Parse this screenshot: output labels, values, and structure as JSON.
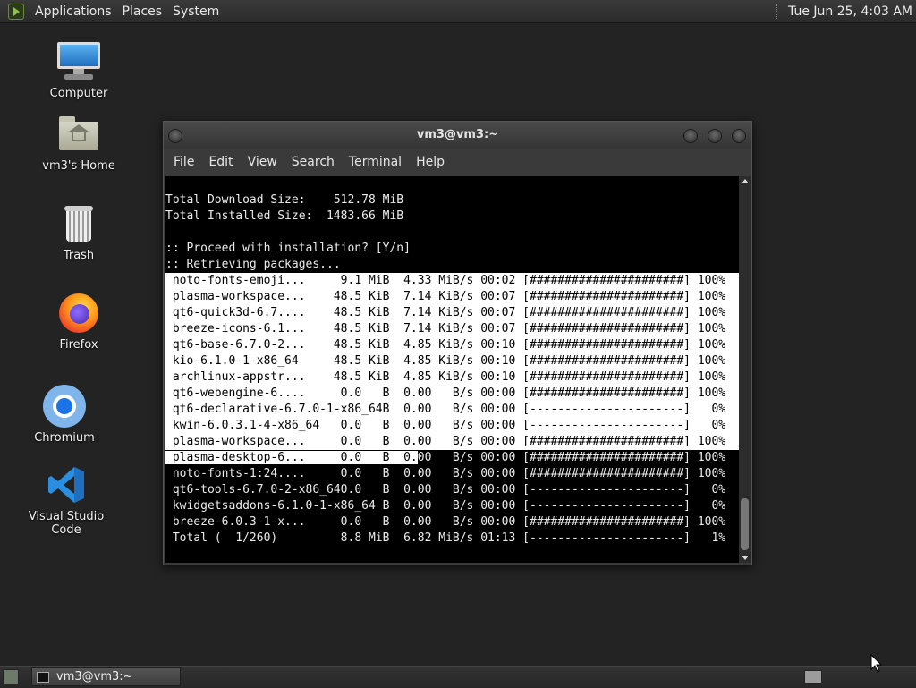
{
  "top_panel": {
    "menus": [
      "Applications",
      "Places",
      "System"
    ],
    "clock": "Tue Jun 25,  4:03 AM"
  },
  "desktop_icons": [
    {
      "label": "Computer",
      "icon": "computer-icon"
    },
    {
      "label": "vm3's Home",
      "icon": "home-folder-icon"
    },
    {
      "label": "Trash",
      "icon": "trash-icon"
    },
    {
      "label": "Firefox",
      "icon": "firefox-icon"
    },
    {
      "label": "Chromium",
      "icon": "chromium-icon"
    },
    {
      "label": "Visual Studio Code",
      "icon": "vscode-icon"
    }
  ],
  "terminal": {
    "title": "vm3@vm3:~",
    "menu": [
      "File",
      "Edit",
      "View",
      "Search",
      "Terminal",
      "Help"
    ],
    "header_lines": [
      "",
      "Total Download Size:    512.78 MiB",
      "Total Installed Size:  1483.66 MiB",
      "",
      ":: Proceed with installation? [Y/n]",
      ":: Retrieving packages..."
    ],
    "highlighted_lines": [
      " noto-fonts-emoji...     9.1 MiB  4.33 MiB/s 00:02 [######################] 100%",
      " plasma-workspace...    48.5 KiB  7.14 KiB/s 00:07 [######################] 100%",
      " qt6-quick3d-6.7....    48.5 KiB  7.14 KiB/s 00:07 [######################] 100%",
      " breeze-icons-6.1...    48.5 KiB  7.14 KiB/s 00:07 [######################] 100%",
      " qt6-base-6.7.0-2...    48.5 KiB  4.85 KiB/s 00:10 [######################] 100%",
      " kio-6.1.0-1-x86_64     48.5 KiB  4.85 KiB/s 00:10 [######################] 100%",
      " archlinux-appstr...    48.5 KiB  4.85 KiB/s 00:10 [######################] 100%",
      " qt6-webengine-6....     0.0   B  0.00   B/s 00:00 [######################] 100%",
      " qt6-declarative-6.7.0-1-x86_64B  0.00   B/s 00:00 [----------------------]   0%",
      " kwin-6.0.3.1-4-x86_64   0.0   B  0.00   B/s 00:00 [----------------------]   0%",
      " plasma-workspace...     0.0   B  0.00   B/s 00:00 [######################] 100%"
    ],
    "partial_line_inverted": " plasma-desktop-6...     0.0   B  0.",
    "partial_line_rest": "00   B/s 00:00 [######################] 100%",
    "trailing_lines": [
      " noto-fonts-1:24....     0.0   B  0.00   B/s 00:00 [######################] 100%",
      " qt6-tools-6.7.0-2-x86_640.0   B  0.00   B/s 00:00 [----------------------]   0%",
      " kwidgetsaddons-6.1.0-1-x86_64 B  0.00   B/s 00:00 [----------------------]   0%",
      " breeze-6.0.3-1-x...     0.0   B  0.00   B/s 00:00 [######################] 100%",
      " Total (  1/260)         8.8 MiB  6.82 MiB/s 01:13 [----------------------]   1%"
    ]
  },
  "taskbar": {
    "task_label": "vm3@vm3:~"
  }
}
